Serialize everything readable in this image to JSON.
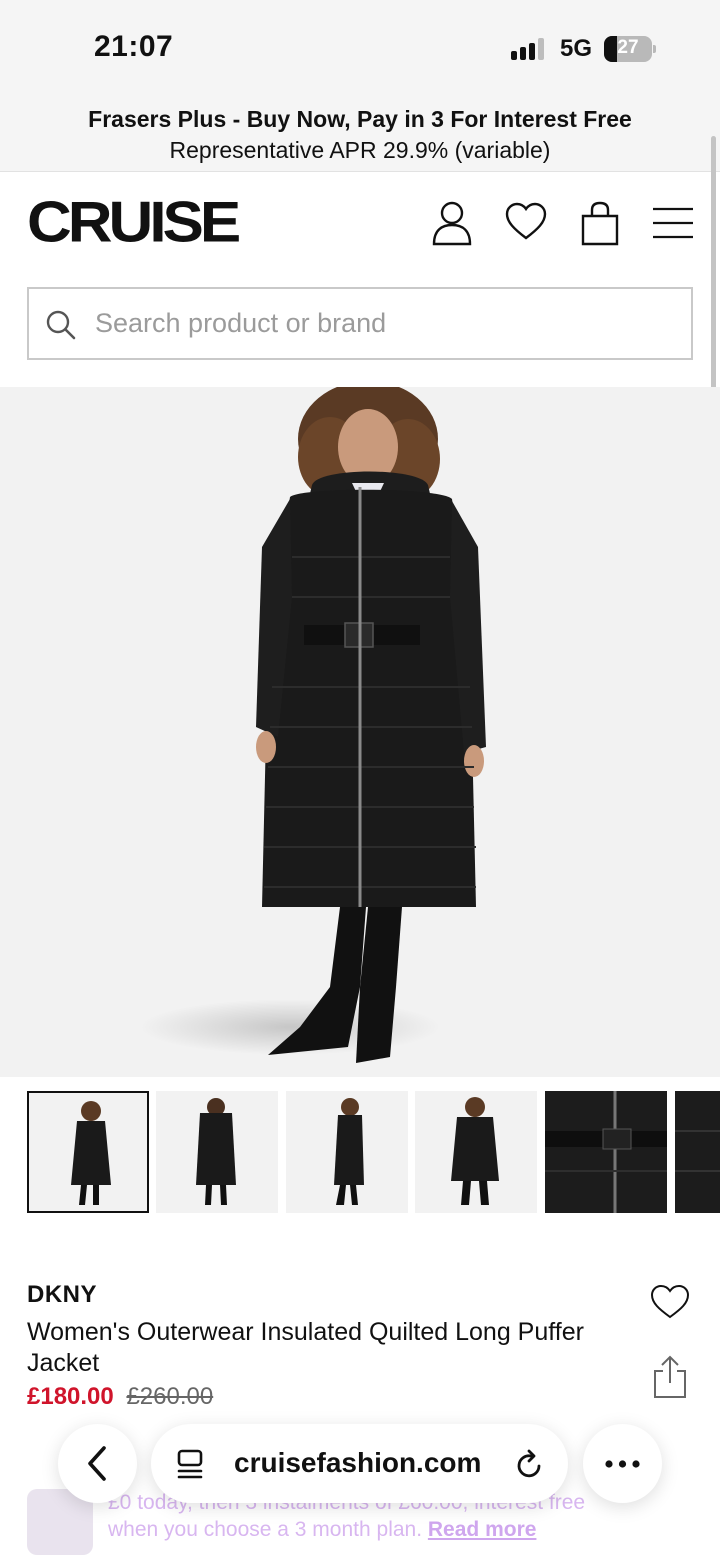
{
  "status_bar": {
    "time": "21:07",
    "network": "5G",
    "battery_level": "27"
  },
  "promo": {
    "title": "Frasers Plus - Buy Now, Pay in 3 For Interest Free",
    "subtitle": "Representative APR 29.9% (variable)"
  },
  "header": {
    "logo": "CRUISE",
    "icons": [
      "account-icon",
      "wishlist-icon",
      "bag-icon",
      "menu-icon"
    ]
  },
  "search": {
    "placeholder": "Search product or brand"
  },
  "gallery": {
    "thumbnail_count": 6,
    "active_index": 0
  },
  "product": {
    "brand": "DKNY",
    "title": "Women's Outerwear Insulated Quilted Long Puffer Jacket",
    "price": "£180.00",
    "was_price": "£260.00"
  },
  "payment_note": {
    "line1": "£0 today, then 3 instalments of £60.00, interest free",
    "line2": "when you choose a 3 month plan.",
    "link": "Read more"
  },
  "browser": {
    "url": "cruisefashion.com"
  },
  "colors": {
    "sale_price": "#d0142b",
    "payment_text": "#d8b6f0"
  }
}
